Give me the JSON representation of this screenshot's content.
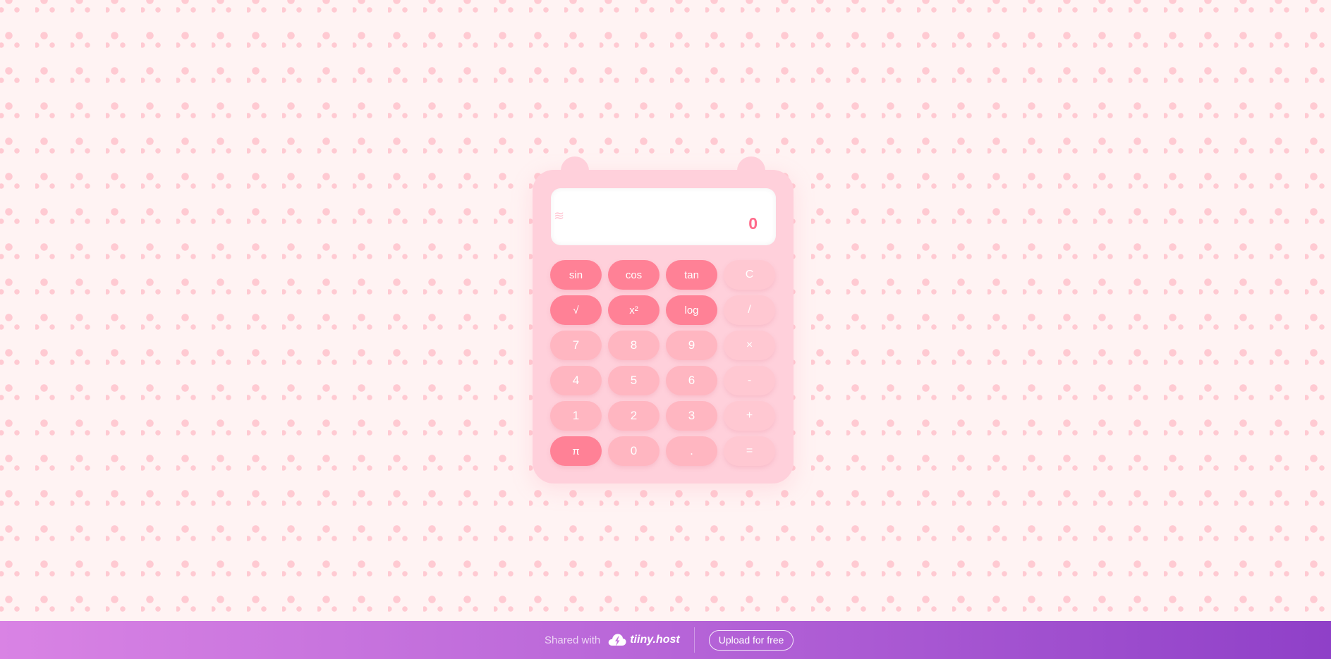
{
  "calculator": {
    "display": {
      "wave_glyph": "≋",
      "value": "0"
    },
    "keys": [
      {
        "label": "sin",
        "kind": "fn",
        "name": "key-sin"
      },
      {
        "label": "cos",
        "kind": "fn",
        "name": "key-cos"
      },
      {
        "label": "tan",
        "kind": "fn",
        "name": "key-tan"
      },
      {
        "label": "C",
        "kind": "op",
        "name": "key-clear"
      },
      {
        "label": "√",
        "kind": "fn",
        "name": "key-sqrt"
      },
      {
        "label": "x²",
        "kind": "fn",
        "name": "key-square"
      },
      {
        "label": "log",
        "kind": "fn",
        "name": "key-log"
      },
      {
        "label": "/",
        "kind": "op",
        "name": "key-divide"
      },
      {
        "label": "7",
        "kind": "num",
        "name": "key-7"
      },
      {
        "label": "8",
        "kind": "num",
        "name": "key-8"
      },
      {
        "label": "9",
        "kind": "num",
        "name": "key-9"
      },
      {
        "label": "×",
        "kind": "op",
        "name": "key-multiply"
      },
      {
        "label": "4",
        "kind": "num",
        "name": "key-4"
      },
      {
        "label": "5",
        "kind": "num",
        "name": "key-5"
      },
      {
        "label": "6",
        "kind": "num",
        "name": "key-6"
      },
      {
        "label": "-",
        "kind": "op",
        "name": "key-subtract"
      },
      {
        "label": "1",
        "kind": "num",
        "name": "key-1"
      },
      {
        "label": "2",
        "kind": "num",
        "name": "key-2"
      },
      {
        "label": "3",
        "kind": "num",
        "name": "key-3"
      },
      {
        "label": "+",
        "kind": "op",
        "name": "key-add"
      },
      {
        "label": "π",
        "kind": "fn",
        "name": "key-pi"
      },
      {
        "label": "0",
        "kind": "num",
        "name": "key-0"
      },
      {
        "label": ".",
        "kind": "num",
        "name": "key-decimal"
      },
      {
        "label": "=",
        "kind": "op",
        "name": "key-equals"
      }
    ]
  },
  "colors": {
    "background": "#fff3f3",
    "dots": "#ffcad2",
    "body": "#ffd0db",
    "function_key": "#ff8196",
    "number_key": "#ffb6c1",
    "operator_key": "#ffc8d2",
    "display_text": "#ff6b8b",
    "footer_start": "#d983e4",
    "footer_end": "#8f40c8"
  },
  "footer": {
    "shared_with": "Shared with",
    "logo_text": "tiiny.host",
    "upload_label": "Upload for free"
  }
}
